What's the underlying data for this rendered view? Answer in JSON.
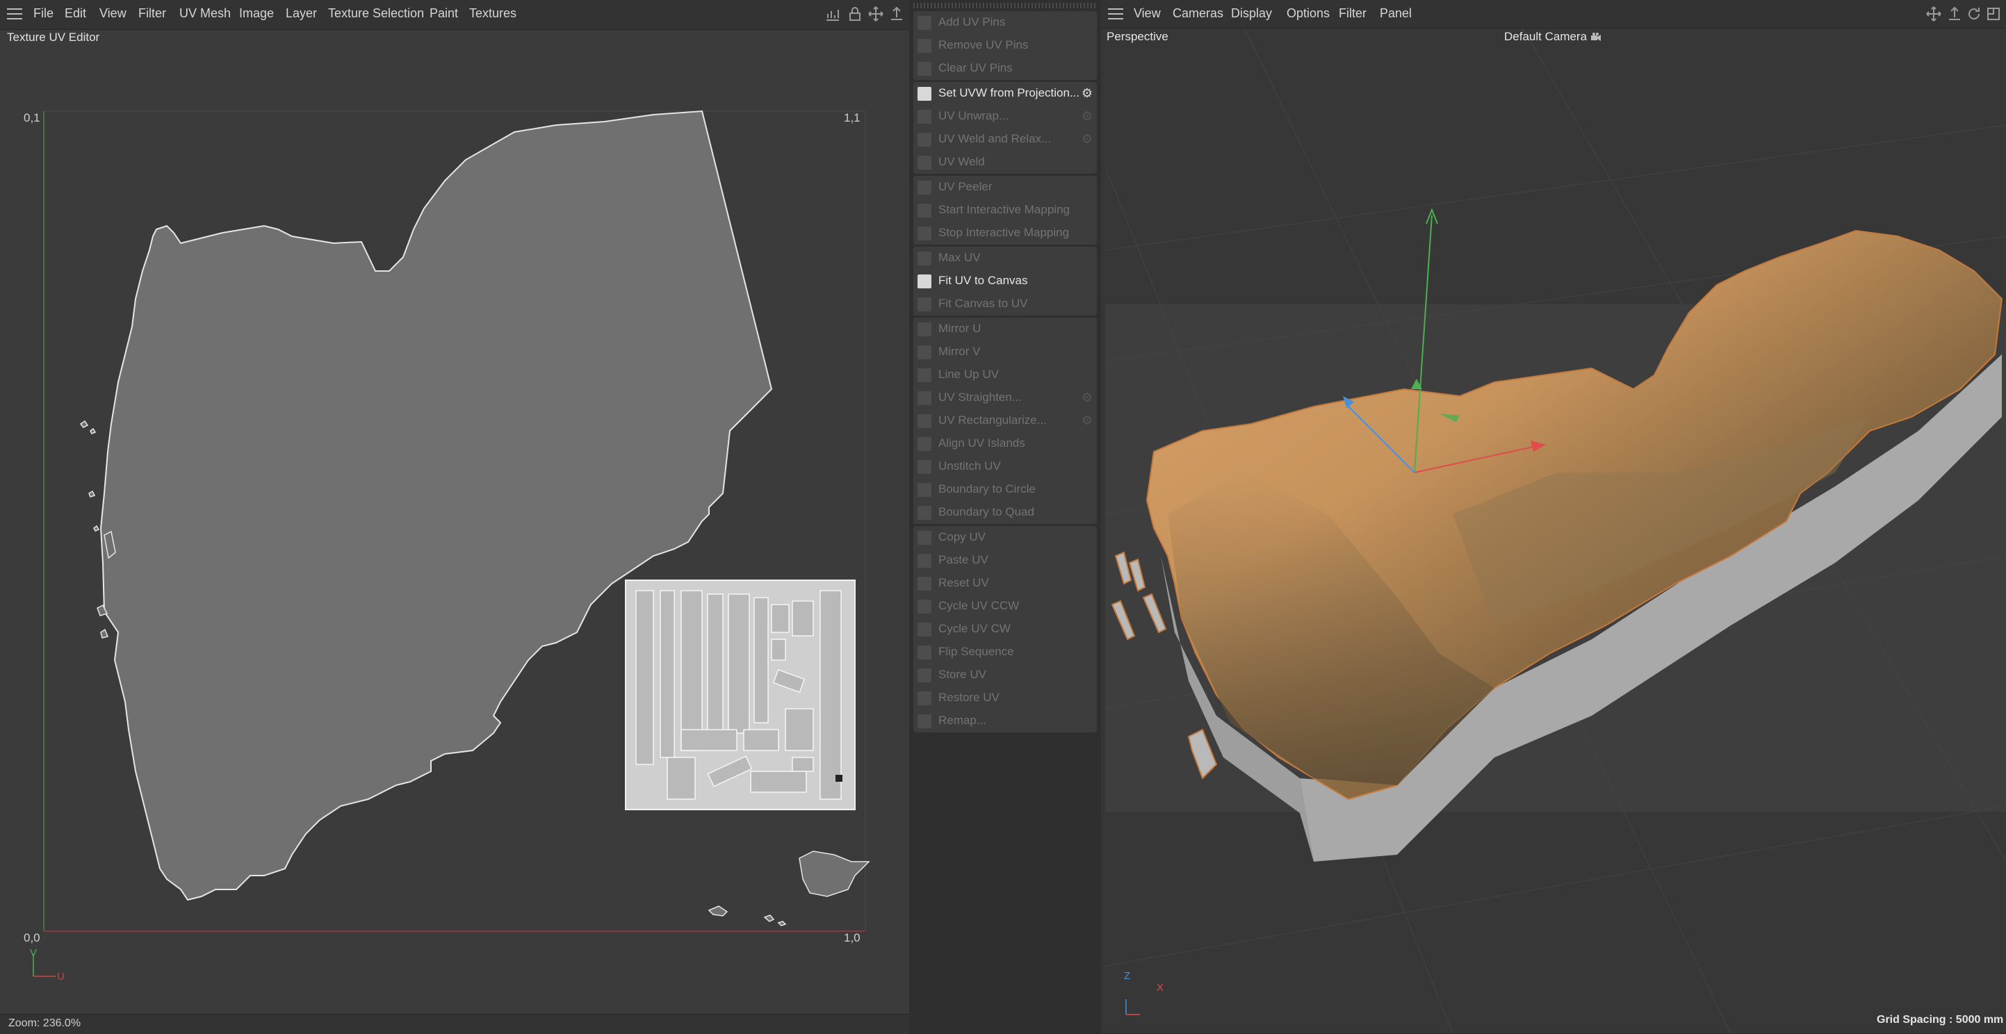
{
  "uv_editor": {
    "menu": [
      "File",
      "Edit",
      "View",
      "Filter",
      "UV Mesh",
      "Image",
      "Layer",
      "Texture Selection",
      "Paint",
      "Textures"
    ],
    "title": "Texture UV Editor",
    "corners": {
      "top_left": "0,1",
      "top_right": "1,1",
      "bottom_left": "0,0",
      "bottom_right": "1,0"
    },
    "axis_v": "V",
    "axis_u": "U",
    "status": "Zoom: 236.0%",
    "toolbar_icons": [
      "chart-icon",
      "lock-icon",
      "move-icon",
      "pan-icon"
    ]
  },
  "uv_commands": {
    "groups": [
      [
        {
          "label": "Add UV Pins",
          "enabled": false,
          "gear": false
        },
        {
          "label": "Remove UV Pins",
          "enabled": false,
          "gear": false
        },
        {
          "label": "Clear UV Pins",
          "enabled": false,
          "gear": false
        }
      ],
      [
        {
          "label": "Set UVW from Projection...",
          "enabled": true,
          "gear": true
        },
        {
          "label": "UV Unwrap...",
          "enabled": false,
          "gear": true
        },
        {
          "label": "UV Weld and Relax...",
          "enabled": false,
          "gear": true
        },
        {
          "label": "UV Weld",
          "enabled": false,
          "gear": false
        }
      ],
      [
        {
          "label": "UV Peeler",
          "enabled": false,
          "gear": false
        },
        {
          "label": "Start Interactive Mapping",
          "enabled": false,
          "gear": false
        },
        {
          "label": "Stop Interactive Mapping",
          "enabled": false,
          "gear": false
        }
      ],
      [
        {
          "label": "Max UV",
          "enabled": false,
          "gear": false
        },
        {
          "label": "Fit UV to Canvas",
          "enabled": true,
          "gear": false
        },
        {
          "label": "Fit Canvas to UV",
          "enabled": false,
          "gear": false
        }
      ],
      [
        {
          "label": "Mirror U",
          "enabled": false,
          "gear": false
        },
        {
          "label": "Mirror V",
          "enabled": false,
          "gear": false
        },
        {
          "label": "Line Up UV",
          "enabled": false,
          "gear": false
        },
        {
          "label": "UV Straighten...",
          "enabled": false,
          "gear": true
        },
        {
          "label": "UV Rectangularize...",
          "enabled": false,
          "gear": true
        },
        {
          "label": "Align UV Islands",
          "enabled": false,
          "gear": false
        },
        {
          "label": "Unstitch UV",
          "enabled": false,
          "gear": false
        },
        {
          "label": "Boundary to Circle",
          "enabled": false,
          "gear": false
        },
        {
          "label": "Boundary to Quad",
          "enabled": false,
          "gear": false
        }
      ],
      [
        {
          "label": "Copy UV",
          "enabled": false,
          "gear": false
        },
        {
          "label": "Paste UV",
          "enabled": false,
          "gear": false
        },
        {
          "label": "Reset UV",
          "enabled": false,
          "gear": false
        },
        {
          "label": "Cycle UV CCW",
          "enabled": false,
          "gear": false
        },
        {
          "label": "Cycle UV CW",
          "enabled": false,
          "gear": false
        },
        {
          "label": "Flip Sequence",
          "enabled": false,
          "gear": false
        },
        {
          "label": "Store UV",
          "enabled": false,
          "gear": false
        },
        {
          "label": "Restore UV",
          "enabled": false,
          "gear": false
        },
        {
          "label": "Remap...",
          "enabled": false,
          "gear": false
        }
      ]
    ]
  },
  "viewport": {
    "menu": [
      "View",
      "Cameras",
      "Display",
      "Options",
      "Filter",
      "Panel"
    ],
    "projection": "Perspective",
    "camera": "Default Camera",
    "camera_icon": "camera-icon",
    "grid_spacing": "Grid Spacing : 5000 mm",
    "axis_labels": {
      "z": "Z",
      "x": "X"
    },
    "toolbar_icons": [
      "move-icon",
      "pan-icon",
      "rotate-icon",
      "maximize-icon"
    ]
  }
}
